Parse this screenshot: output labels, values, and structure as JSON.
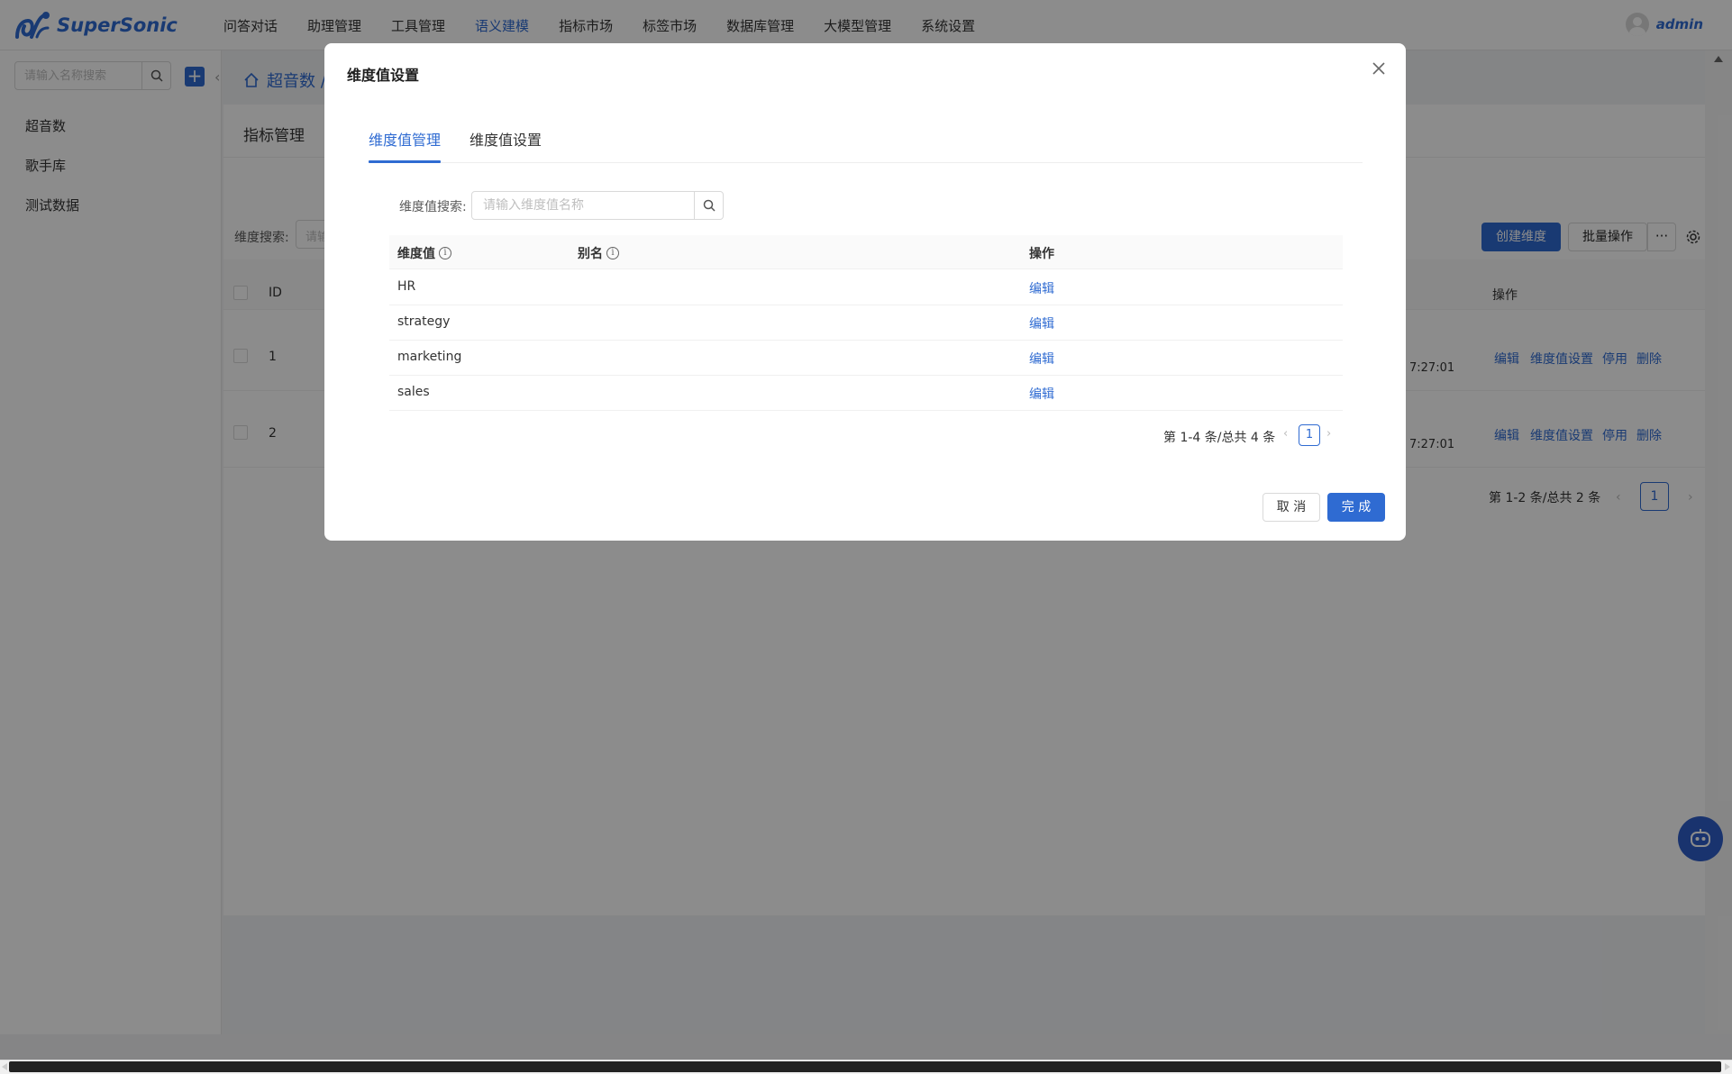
{
  "app": {
    "name": "SuperSonic",
    "user": "admin",
    "nav": [
      "问答对话",
      "助理管理",
      "工具管理",
      "语义建模",
      "指标市场",
      "标签市场",
      "数据库管理",
      "大模型管理",
      "系统设置"
    ],
    "active_nav": "语义建模",
    "accent_color": "#2f6bd2"
  },
  "sidebar": {
    "search_placeholder": "请输入名称搜索",
    "items": [
      "超音数",
      "歌手库",
      "测试数据"
    ]
  },
  "main": {
    "breadcrumb": "超音数 /",
    "tab": "指标管理",
    "search_label": "维度搜索:",
    "search_placeholder": "请输",
    "create_button": "创建维度",
    "batch_button": "批量操作",
    "more_button": "···",
    "table": {
      "headers": [
        "ID",
        "操作"
      ],
      "rows": [
        {
          "id": "1",
          "time": "7:27:01",
          "actions": [
            "编辑",
            "维度值设置",
            "停用",
            "删除"
          ]
        },
        {
          "id": "2",
          "time": "7:27:01",
          "actions": [
            "编辑",
            "维度值设置",
            "停用",
            "删除"
          ]
        }
      ]
    },
    "pagination": {
      "summary": "第 1-2 条/总共 2 条",
      "current": "1"
    }
  },
  "modal": {
    "title": "维度值设置",
    "tabs": [
      "维度值管理",
      "维度值设置"
    ],
    "active_tab": "维度值管理",
    "search_label": "维度值搜索:",
    "search_placeholder": "请输入维度值名称",
    "table": {
      "headers": [
        "维度值",
        "别名",
        "操作"
      ],
      "rows": [
        {
          "value": "HR",
          "alias": "",
          "action": "编辑"
        },
        {
          "value": "strategy",
          "alias": "",
          "action": "编辑"
        },
        {
          "value": "marketing",
          "alias": "",
          "action": "编辑"
        },
        {
          "value": "sales",
          "alias": "",
          "action": "编辑"
        }
      ]
    },
    "pagination": {
      "summary": "第 1-4 条/总共 4 条",
      "current": "1"
    },
    "cancel_button": "取 消",
    "ok_button": "完 成"
  }
}
